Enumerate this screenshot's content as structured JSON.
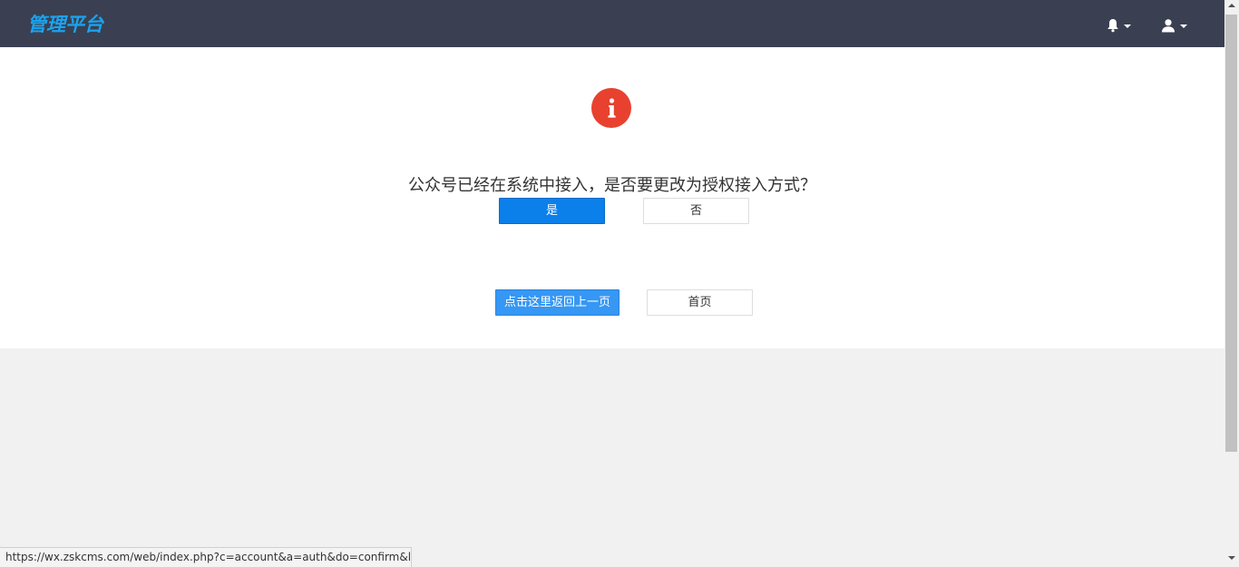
{
  "header": {
    "brand": "管理平台",
    "bell_icon": "bell-icon",
    "user_icon": "user-icon",
    "caret_icon": "caret-down-icon",
    "background_color": "#3a4052",
    "brand_color": "#1ba3ee"
  },
  "dialog": {
    "icon": "info-icon",
    "icon_color": "#e8412f",
    "message": "公众号已经在系统中接入，是否要更改为授权接入方式？",
    "yes_label": "是",
    "no_label": "否"
  },
  "actions": {
    "back_label": "点击这里返回上一页",
    "home_label": "首页"
  },
  "status_bar": {
    "url": "https://wx.zskcms.com/web/index.php?c=account&a=auth&do=confirm&l..."
  },
  "colors": {
    "primary_button": "#0b7fea",
    "secondary_button": "#3697f4"
  }
}
